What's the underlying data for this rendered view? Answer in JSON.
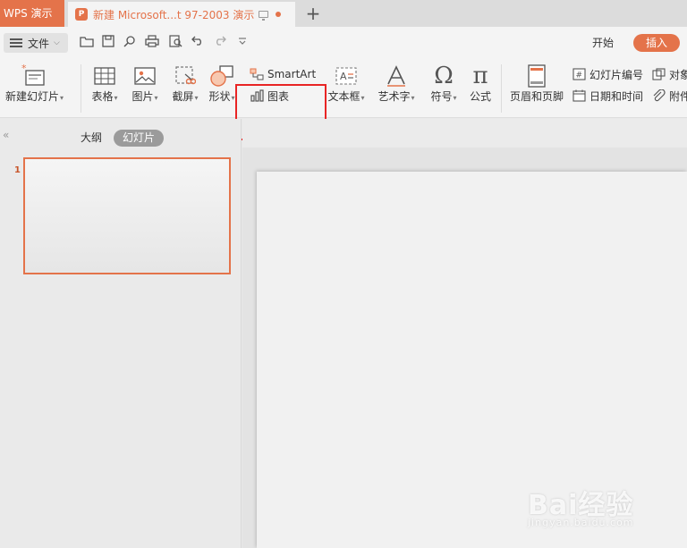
{
  "tabbar": {
    "app_tab": "WPS 演示",
    "doc_icon": "P",
    "doc_title": "新建 Microsoft...t 97-2003 演示",
    "new_tab": "+"
  },
  "menubar": {
    "file_label": "文件",
    "tabs": {
      "start": "开始",
      "insert": "插入"
    }
  },
  "ribbon": {
    "new_slide": "新建幻灯片",
    "table": "表格",
    "picture": "图片",
    "screenshot": "截屏",
    "shape": "形状",
    "smartart": "SmartArt",
    "chart": "图表",
    "textbox": "文本框",
    "wordart": "艺术字",
    "symbol": "符号",
    "formula": "公式",
    "header_footer": "页眉和页脚",
    "slide_number": "幻灯片编号",
    "date_time": "日期和时间",
    "object": "对象",
    "attachment": "附件"
  },
  "leftpane": {
    "outline_tab": "大纲",
    "slides_tab": "幻灯片",
    "slide_number": "1"
  },
  "watermark": {
    "logo": "Bai经验",
    "url": "jingyan.baidu.com"
  },
  "colors": {
    "accent": "#e4734a",
    "highlight_box": "#e82424"
  }
}
